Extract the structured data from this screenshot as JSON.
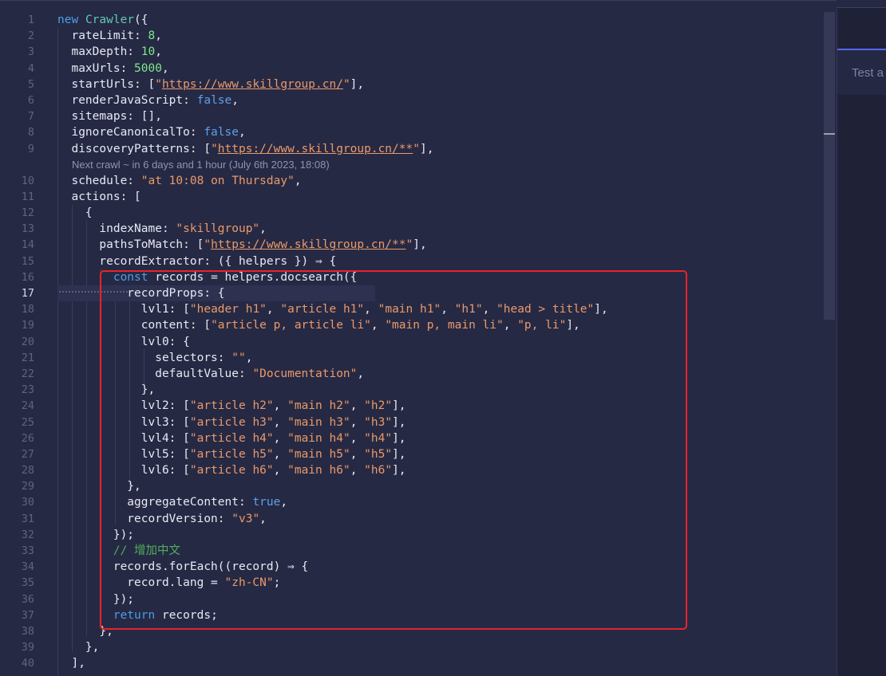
{
  "editor": {
    "crawl_hint": "Next crawl ~ in 6 days and 1 hour (July 6th 2023, 18:08)",
    "active_line": "17",
    "line_numbers": [
      "1",
      "2",
      "3",
      "4",
      "5",
      "6",
      "7",
      "8",
      "9",
      "10",
      "11",
      "12",
      "13",
      "14",
      "15",
      "16",
      "17",
      "18",
      "19",
      "20",
      "21",
      "22",
      "23",
      "24",
      "25",
      "26",
      "27",
      "28",
      "29",
      "30",
      "31",
      "32",
      "33",
      "34",
      "35",
      "36",
      "37",
      "38",
      "39",
      "40"
    ],
    "lines": [
      "new Crawler({",
      "  rateLimit: 8,",
      "  maxDepth: 10,",
      "  maxUrls: 5000,",
      "  startUrls: [\"https://www.skillgroup.cn/\"],",
      "  renderJavaScript: false,",
      "  sitemaps: [],",
      "  ignoreCanonicalTo: false,",
      "  discoveryPatterns: [\"https://www.skillgroup.cn/**\"],",
      "  schedule: \"at 10:08 on Thursday\",",
      "  actions: [",
      "    {",
      "      indexName: \"skillgroup\",",
      "      pathsToMatch: [\"https://www.skillgroup.cn/**\"],",
      "      recordExtractor: ({ helpers }) ⇒ {",
      "        const records = helpers.docsearch({",
      "          recordProps: {",
      "            lvl1: [\"header h1\", \"article h1\", \"main h1\", \"h1\", \"head > title\"],",
      "            content: [\"article p, article li\", \"main p, main li\", \"p, li\"],",
      "            lvl0: {",
      "              selectors: \"\",",
      "              defaultValue: \"Documentation\",",
      "            },",
      "            lvl2: [\"article h2\", \"main h2\", \"h2\"],",
      "            lvl3: [\"article h3\", \"main h3\", \"h3\"],",
      "            lvl4: [\"article h4\", \"main h4\", \"h4\"],",
      "            lvl5: [\"article h5\", \"main h5\", \"h5\"],",
      "            lvl6: [\"article h6\", \"main h6\", \"h6\"],",
      "          },",
      "          aggregateContent: true,",
      "          recordVersion: \"v3\",",
      "        });",
      "        // 增加中文",
      "        records.forEach((record) ⇒ {",
      "          record.lang = \"zh-CN\";",
      "        });",
      "        return records;",
      "      },",
      "    },",
      "  ],"
    ]
  },
  "side_panel": {
    "tab_label": "Test a"
  },
  "colors": {
    "keyword": "#4d9ee6",
    "class": "#5fc9b6",
    "number": "#7ee787",
    "string": "#e99a6a",
    "comment": "#4fae5a",
    "highlight_border": "#e8232a"
  }
}
